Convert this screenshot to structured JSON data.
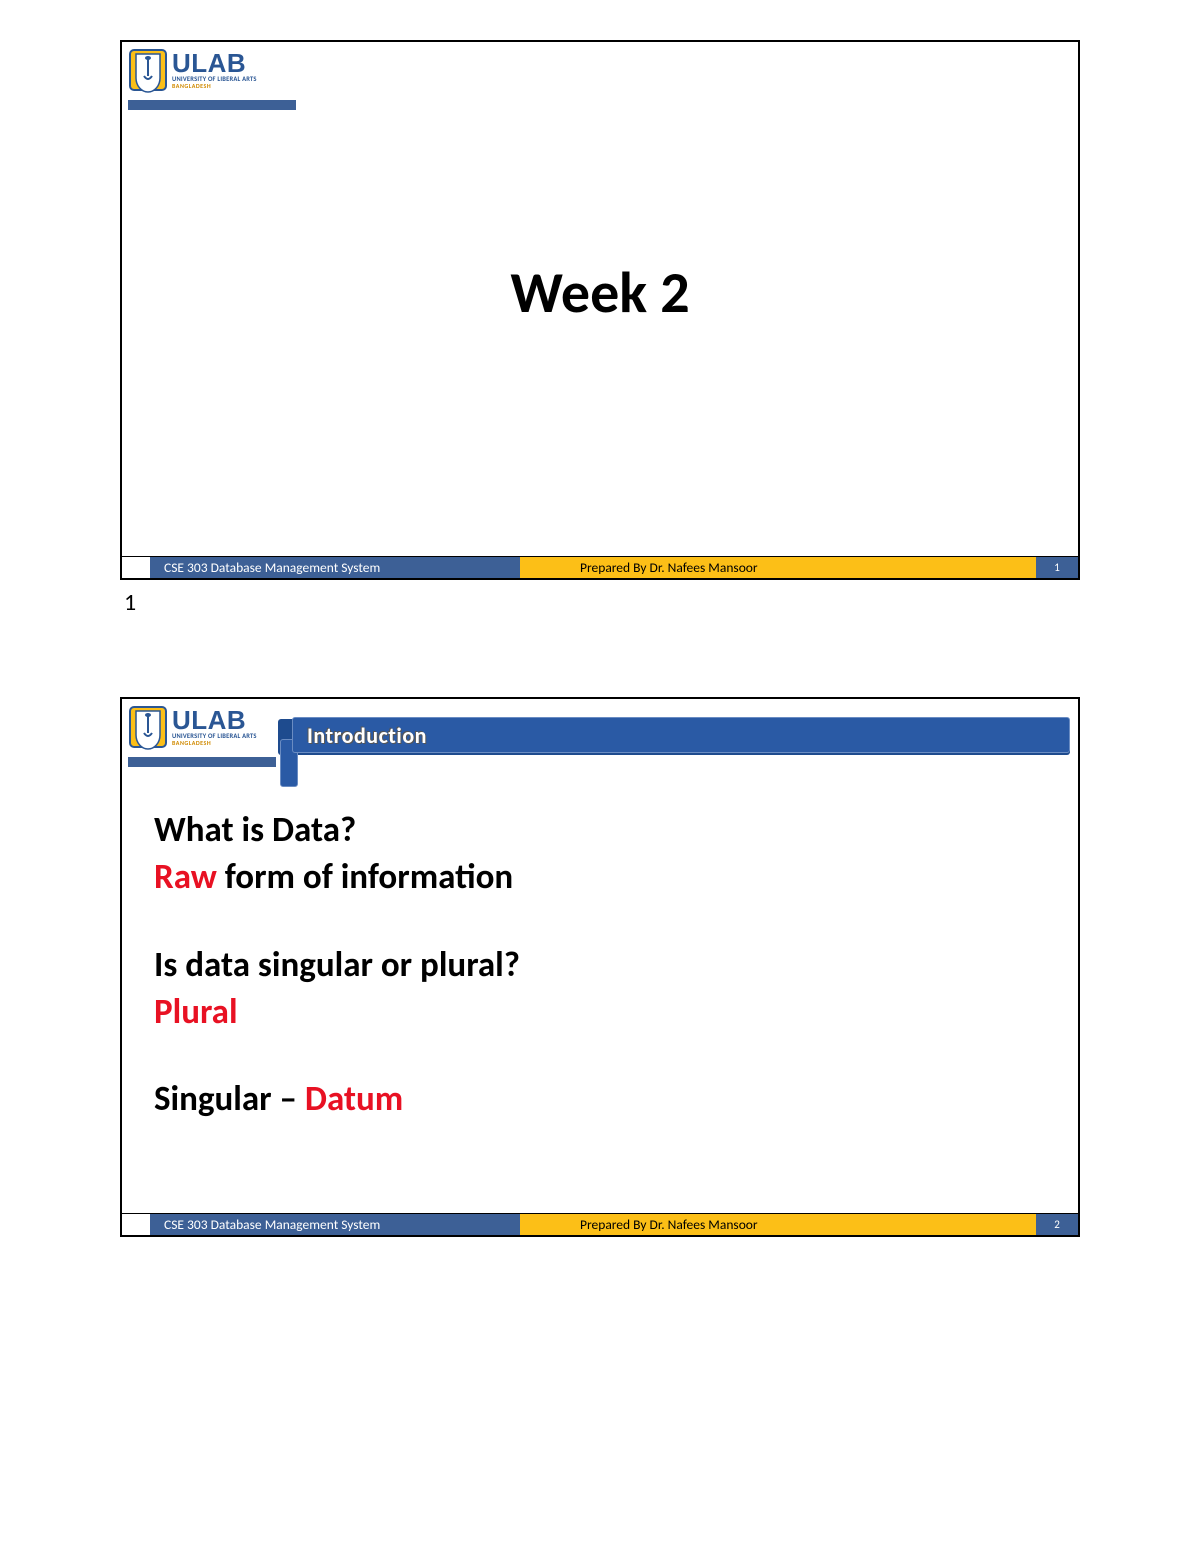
{
  "logo": {
    "name": "ULAB",
    "subtitle": "UNIVERSITY OF LIBERAL ARTS",
    "country": "BANGLADESH"
  },
  "footer": {
    "course": "CSE 303 Database Management System",
    "prepared": "Prepared By Dr. Nafees Mansoor"
  },
  "slide1": {
    "title": "Week 2",
    "page": "1",
    "handout_number": "1"
  },
  "slide2": {
    "banner_title": "Introduction",
    "line1": "What is Data?",
    "line2a": "Raw",
    "line2b": " form of information",
    "line3": "Is data singular or plural?",
    "line4": "Plural",
    "line5a": "Singular – ",
    "line5b": "Datum",
    "page": "2"
  }
}
